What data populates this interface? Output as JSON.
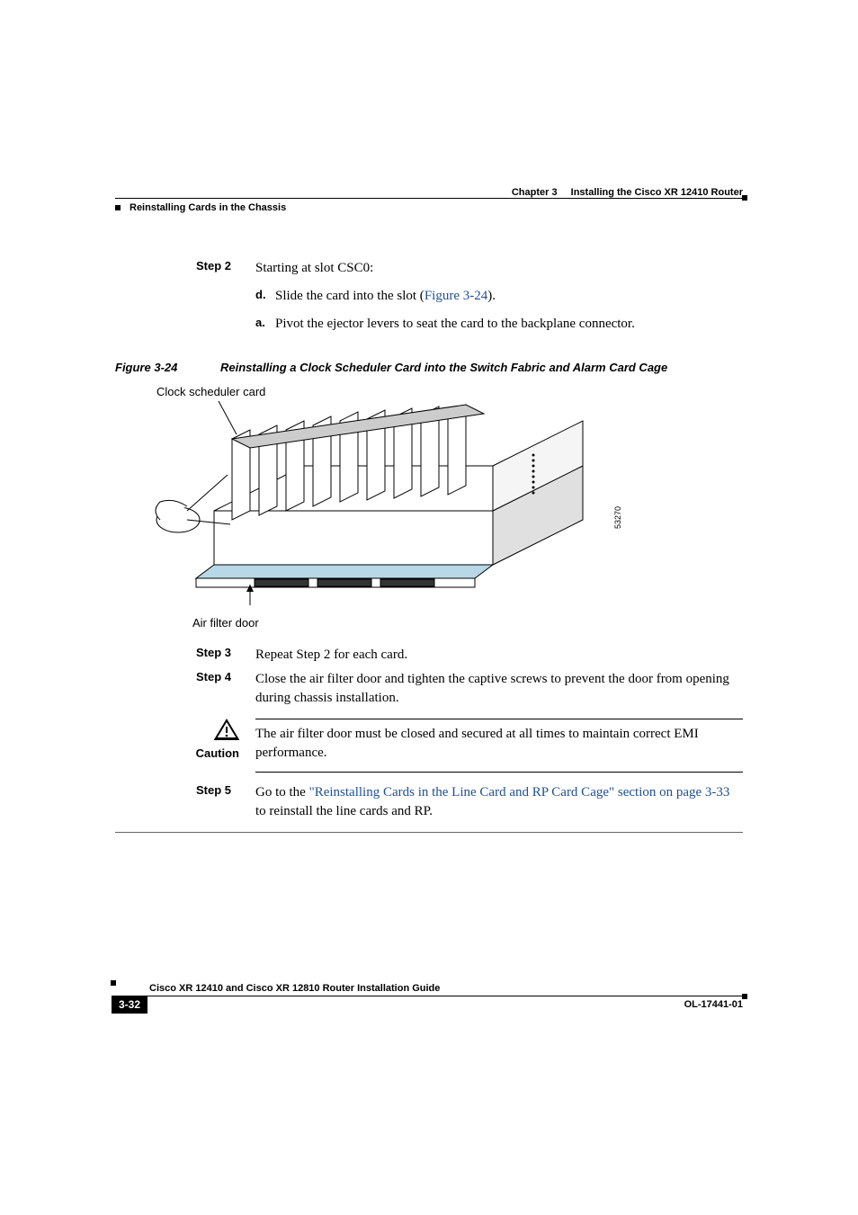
{
  "header": {
    "chapter_num": "Chapter 3",
    "chapter_title": "Installing the Cisco XR 12410 Router",
    "section": "Reinstalling Cards in the Chassis"
  },
  "steps": {
    "s2": {
      "label": "Step 2",
      "text": "Starting at slot CSC0:"
    },
    "s2d": {
      "label": "d.",
      "prefix": "Slide the card into the slot (",
      "link": "Figure 3-24",
      "suffix": ")."
    },
    "s2a": {
      "label": "a.",
      "text": "Pivot the ejector levers to seat the card to the backplane connector."
    },
    "s3": {
      "label": "Step 3",
      "text": "Repeat Step 2 for each card."
    },
    "s4": {
      "label": "Step 4",
      "text": "Close the air filter door and tighten the captive screws to prevent the door from opening during chassis installation."
    },
    "s5": {
      "label": "Step 5",
      "prefix": "Go to the ",
      "link": "\"Reinstalling Cards in the Line Card and RP Card Cage\" section on page 3-33",
      "suffix": " to reinstall the line cards and RP."
    }
  },
  "figure": {
    "num": "Figure 3-24",
    "title": "Reinstalling a Clock Scheduler Card into the Switch Fabric and Alarm Card Cage",
    "callout_top": "Clock scheduler card",
    "callout_bottom": "Air filter door",
    "img_id": "53270"
  },
  "caution": {
    "label": "Caution",
    "text": "The air filter door must be closed and secured at all times to maintain correct EMI performance."
  },
  "footer": {
    "guide": "Cisco XR 12410 and Cisco XR 12810 Router Installation Guide",
    "page": "3-32",
    "docid": "OL-17441-01"
  }
}
